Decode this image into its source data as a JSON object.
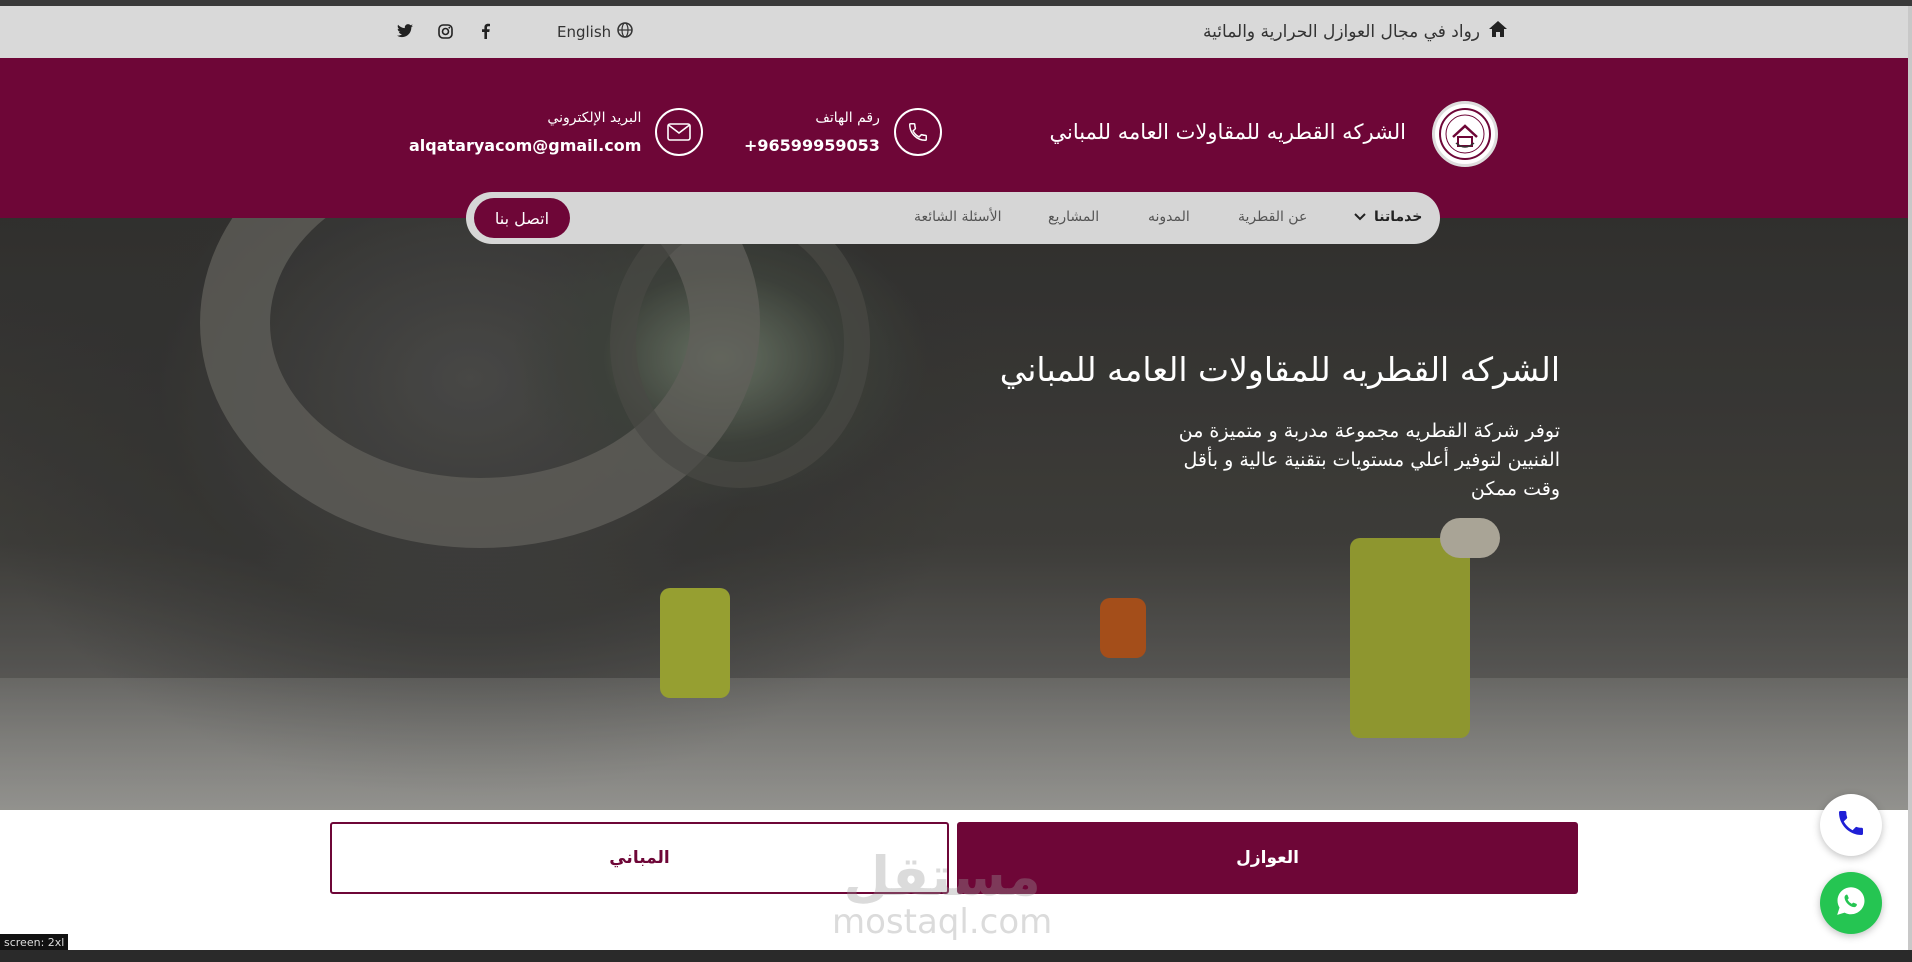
{
  "topbar": {
    "tagline": "رواد في مجال العوازل الحرارية والمائية",
    "language": "English",
    "socials": [
      "twitter-icon",
      "instagram-icon",
      "facebook-icon"
    ]
  },
  "header": {
    "brand": "الشركه القطريه للمقاولات العامه للمباني",
    "phone_label": "رقم الهاتف",
    "phone_value": "+96599959053",
    "email_label": "البريد الإلكتروني",
    "email_value": "alqataryacom@gmail.com"
  },
  "nav": {
    "services": "خدماتنا",
    "about": "عن القطرية",
    "blog": "المدونه",
    "projects": "المشاريع",
    "faq": "الأسئلة الشائعة",
    "cta": "اتصل بنا"
  },
  "hero": {
    "title": "الشركه القطريه للمقاولات العامه للمباني",
    "text": "توفر شركة القطريه مجموعة مدربة و متميزة من الفنيين لتوفير أعلي مستويات بتقنية عالية و بأقل وقت ممكن"
  },
  "tabs": {
    "insulation": "العوازل",
    "buildings": "المباني"
  },
  "watermark": {
    "big": "مستقل",
    "small": "mostaql.com"
  },
  "screen_label": "screen: 2xl",
  "colors": {
    "brand": "#6e0637",
    "topbar": "#d9d9d9",
    "whatsapp": "#25c552",
    "phone_fab": "#1f1fd6"
  }
}
